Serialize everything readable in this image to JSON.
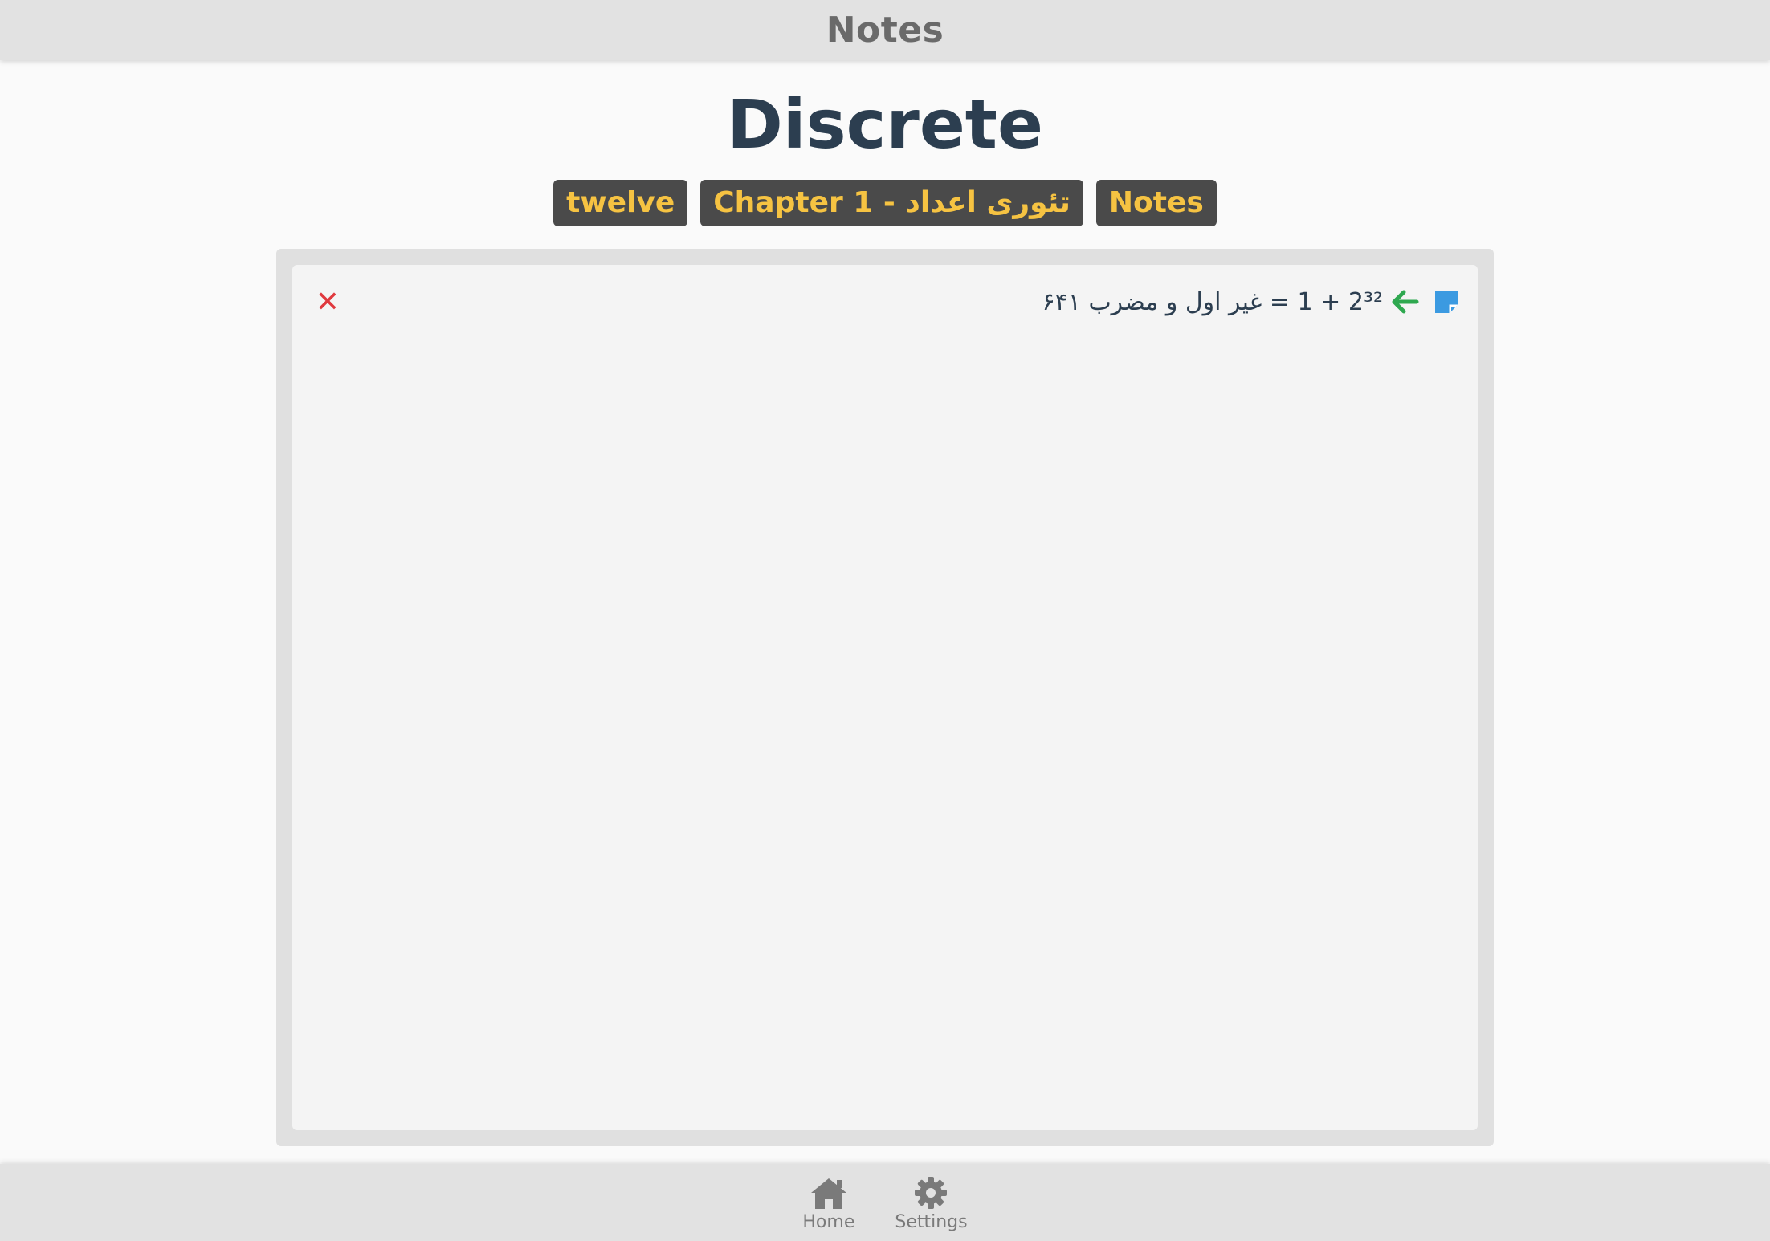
{
  "header": {
    "title": "Notes"
  },
  "page": {
    "title": "Discrete"
  },
  "tags": [
    {
      "label": "twelve"
    },
    {
      "label": "Chapter 1 - تئوری اعداد"
    },
    {
      "label": "Notes"
    }
  ],
  "note": {
    "text": "2³² + 1 = غیر اول و مضرب ۶۴۱",
    "arrow_icon": "arrow-left-icon",
    "note_icon": "sticky-note-icon"
  },
  "close": {
    "icon": "close-icon",
    "glyph": "✕"
  },
  "nav": {
    "items": [
      {
        "label": "Home",
        "icon": "home-icon"
      },
      {
        "label": "Settings",
        "icon": "gear-icon"
      }
    ]
  },
  "colors": {
    "tag_bg": "#4a4a4a",
    "tag_text": "#f6c342",
    "arrow": "#2ea84f",
    "note_icon": "#3b9ae1",
    "close": "#e0393e",
    "title": "#2c3e50"
  }
}
